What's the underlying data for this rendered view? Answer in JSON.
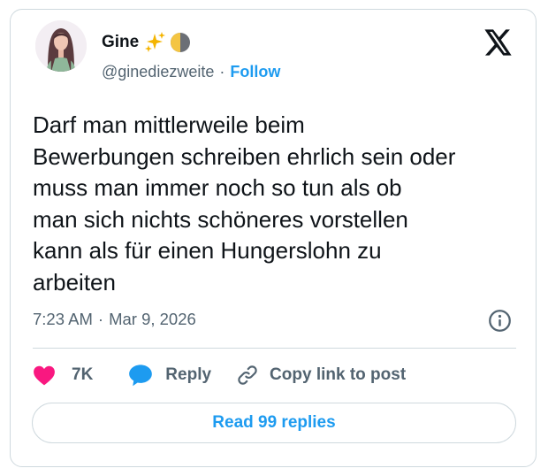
{
  "author": {
    "display_name": "Gine",
    "name_emojis": [
      "sparkles-emoji",
      "half-moon-emoji"
    ],
    "handle": "@ginediezweite",
    "separator": "·",
    "follow_label": "Follow",
    "avatar": "woman-avatar"
  },
  "tweet": {
    "text_lines": [
      "Darf man mittlerweile beim",
      "Bewerbungen schreiben ehrlich sein oder",
      "muss man immer noch so tun als ob",
      "man sich nichts schöneres vorstellen",
      "kann als für einen Hungerslohn zu",
      "arbeiten"
    ],
    "time": "7:23 AM",
    "date_separator": "·",
    "date": "Mar 9, 2026"
  },
  "actions": {
    "like_count": "7K",
    "reply_label": "Reply",
    "copy_label": "Copy link to post"
  },
  "footer": {
    "read_replies_label": "Read 99 replies"
  },
  "colors": {
    "accent": "#1d9bf0",
    "like": "#f91880",
    "text": "#0f1419",
    "muted": "#536471",
    "border": "#cfd9de"
  },
  "icons": [
    "x-logo-icon",
    "info-icon",
    "heart-icon",
    "reply-bubble-icon",
    "link-icon"
  ]
}
